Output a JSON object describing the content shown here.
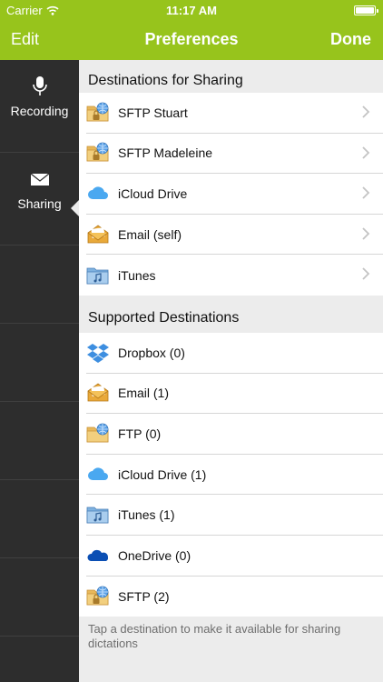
{
  "status": {
    "carrier": "Carrier",
    "time": "11:17 AM"
  },
  "nav": {
    "edit": "Edit",
    "title": "Preferences",
    "done": "Done"
  },
  "sidebar": {
    "items": [
      {
        "label": "Recording",
        "icon": "microphone-icon"
      },
      {
        "label": "Sharing",
        "icon": "envelope-icon"
      }
    ]
  },
  "sharing": {
    "header": "Destinations for Sharing",
    "items": [
      {
        "label": "SFTP Stuart",
        "icon": "sftp-folder-icon"
      },
      {
        "label": "SFTP Madeleine",
        "icon": "sftp-folder-icon"
      },
      {
        "label": "iCloud Drive",
        "icon": "icloud-icon"
      },
      {
        "label": "Email (self)",
        "icon": "email-icon"
      },
      {
        "label": "iTunes",
        "icon": "itunes-folder-icon"
      }
    ]
  },
  "supported": {
    "header": "Supported Destinations",
    "items": [
      {
        "label": "Dropbox (0)",
        "icon": "dropbox-icon"
      },
      {
        "label": "Email (1)",
        "icon": "email-icon"
      },
      {
        "label": "FTP (0)",
        "icon": "ftp-folder-icon"
      },
      {
        "label": "iCloud Drive (1)",
        "icon": "icloud-icon"
      },
      {
        "label": "iTunes (1)",
        "icon": "itunes-folder-icon"
      },
      {
        "label": "OneDrive (0)",
        "icon": "onedrive-icon"
      },
      {
        "label": "SFTP (2)",
        "icon": "sftp-folder-icon"
      }
    ],
    "footer": "Tap a destination to make it available for sharing dictations"
  },
  "colors": {
    "accent": "#97c41c",
    "sidebar": "#2d2d2d",
    "background": "#ececec"
  }
}
